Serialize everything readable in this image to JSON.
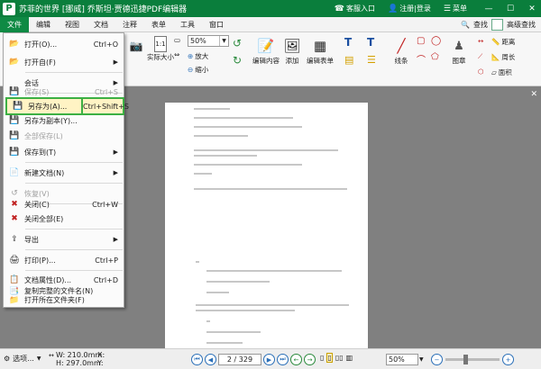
{
  "window": {
    "title": "苏菲的世界 [挪威] 乔斯坦·贾德迅捷PDF编辑器",
    "customer_service": "客服入口",
    "login": "注册|登录",
    "menu_label": "菜单"
  },
  "menubar": {
    "items": [
      "文件",
      "编辑",
      "视图",
      "文档",
      "注释",
      "表单",
      "工具",
      "窗口"
    ],
    "find": "查找",
    "advanced_search": "高级查找"
  },
  "toolbar": {
    "actual_size": "实际大小",
    "zoom_value": "50%",
    "zoom_in": "放大",
    "zoom_out": "缩小",
    "edit_content": "编辑内容",
    "add": "添加",
    "edit_form": "编辑表单",
    "line": "线条",
    "stamp": "图章",
    "distance": "距离",
    "perimeter": "周长",
    "area": "面积"
  },
  "file_menu": {
    "items": [
      {
        "label": "打开(O)...",
        "shortcut": "Ctrl+O",
        "icon": "open-folder-icon",
        "disabled": false,
        "submenu": false
      },
      {
        "label": "打开自(F)",
        "shortcut": "",
        "icon": "open-from-icon",
        "disabled": false,
        "submenu": true
      },
      {
        "label": "会话",
        "shortcut": "",
        "icon": "",
        "disabled": false,
        "submenu": true
      },
      {
        "label": "保存(S)",
        "shortcut": "Ctrl+S",
        "icon": "save-icon",
        "disabled": true,
        "submenu": false
      },
      {
        "label": "另存为(A)...",
        "shortcut": "Ctrl+Shift+S",
        "icon": "save-as-icon",
        "disabled": false,
        "submenu": false
      },
      {
        "label": "另存为副本(Y)...",
        "shortcut": "",
        "icon": "save-copy-icon",
        "disabled": false,
        "submenu": false
      },
      {
        "label": "全部保存(L)",
        "shortcut": "",
        "icon": "save-all-icon",
        "disabled": true,
        "submenu": false
      },
      {
        "label": "保存到(T)",
        "shortcut": "",
        "icon": "save-to-icon",
        "disabled": false,
        "submenu": true
      },
      {
        "label": "新建文档(N)",
        "shortcut": "",
        "icon": "new-document-icon",
        "disabled": false,
        "submenu": true
      },
      {
        "label": "恢复(V)",
        "shortcut": "",
        "icon": "revert-icon",
        "disabled": true,
        "submenu": false
      },
      {
        "label": "关闭(C)",
        "shortcut": "Ctrl+W",
        "icon": "close-doc-icon",
        "disabled": false,
        "submenu": false
      },
      {
        "label": "关闭全部(E)",
        "shortcut": "",
        "icon": "close-all-icon",
        "disabled": false,
        "submenu": false
      },
      {
        "label": "导出",
        "shortcut": "",
        "icon": "export-icon",
        "disabled": false,
        "submenu": true
      },
      {
        "label": "打印(P)...",
        "shortcut": "Ctrl+P",
        "icon": "print-icon",
        "disabled": false,
        "submenu": false
      },
      {
        "label": "文档属性(D)...",
        "shortcut": "Ctrl+D",
        "icon": "properties-icon",
        "disabled": false,
        "submenu": false
      },
      {
        "label": "复制完整的文件名(N)",
        "shortcut": "",
        "icon": "copy-filename-icon",
        "disabled": false,
        "submenu": false
      },
      {
        "label": "打开所在文件夹(F)",
        "shortcut": "",
        "icon": "open-folder-location-icon",
        "disabled": false,
        "submenu": false
      }
    ]
  },
  "statusbar": {
    "options": "选项...",
    "width": "W: 210.0mm",
    "height": "H: 297.0mm",
    "x": "X:",
    "y": "Y:",
    "page_indicator": "2 / 329",
    "zoom": "50%"
  },
  "colors": {
    "title_green": "#0a7e3c",
    "highlight_border": "#3cb043",
    "highlight_fill": "#fff3c4"
  }
}
